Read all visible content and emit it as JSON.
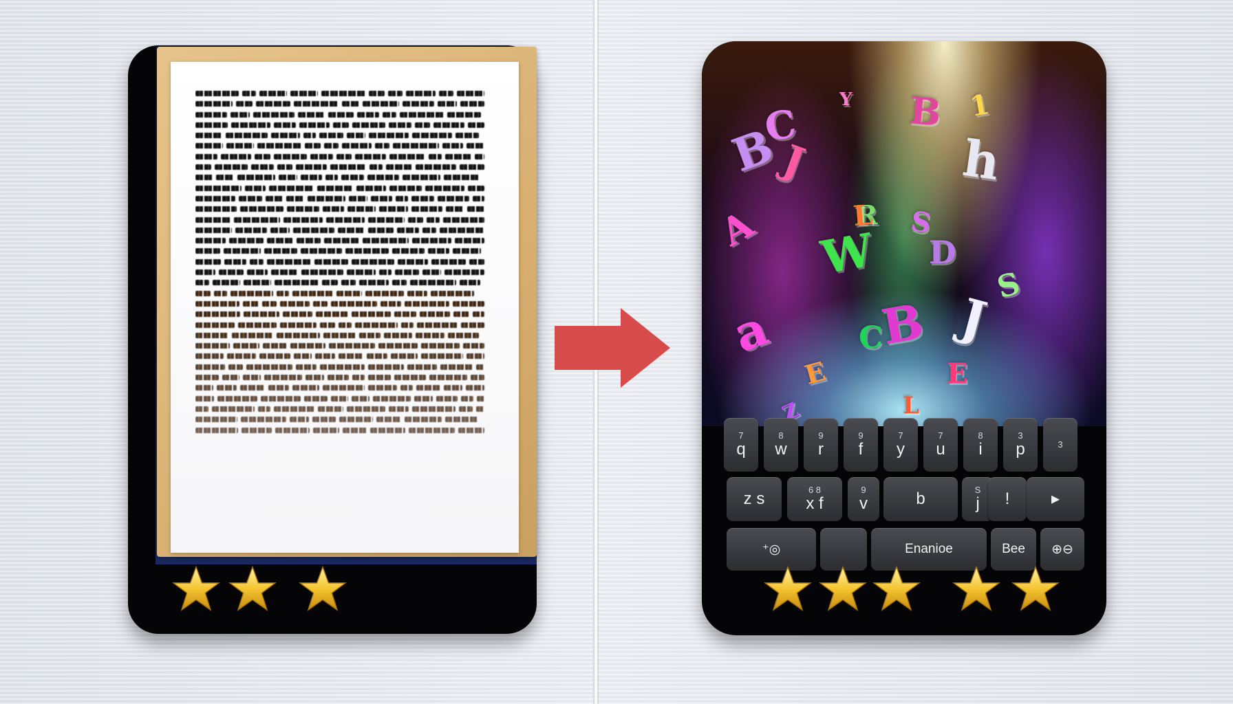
{
  "left_panel": {
    "document_lines": 33,
    "rating_stars": 3
  },
  "arrow": {
    "color": "#d84b4b"
  },
  "right_panel": {
    "letters": [
      "B",
      "C",
      "B",
      "h",
      "A",
      "J",
      "R",
      "L",
      "W",
      "S",
      "a",
      "B",
      "J",
      "C",
      "E",
      "L",
      "E",
      "Z",
      "D",
      "S",
      "Y",
      "1"
    ],
    "keyboard": {
      "row1": [
        {
          "sup": "7",
          "main": "q"
        },
        {
          "sup": "8",
          "main": "w"
        },
        {
          "sup": "9",
          "main": "r"
        },
        {
          "sup": "9",
          "main": "f"
        },
        {
          "sup": "7",
          "main": "y"
        },
        {
          "sup": "7",
          "main": "u"
        },
        {
          "sup": "8",
          "main": "i"
        },
        {
          "sup": "3",
          "main": "p"
        },
        {
          "sup": "3",
          "main": ""
        }
      ],
      "row2": [
        {
          "sup": "",
          "main": "z s"
        },
        {
          "sup": "6 8",
          "main": "x f"
        },
        {
          "sup": "9",
          "main": "v"
        },
        {
          "sup": "",
          "main": "b"
        },
        {
          "sup": "S",
          "main": "j"
        },
        {
          "sup": "",
          "main": "!"
        },
        {
          "sup": "",
          "main": "▸"
        }
      ],
      "row3": {
        "left_key": "⁺◎",
        "space_key": "Enanioe",
        "key_bee": "Bee",
        "key_globe": "⊕⊖"
      }
    },
    "rating_stars": 5
  },
  "colors": {
    "star": "#f5c531",
    "tablet": "#050507",
    "folder": "#d9b072"
  }
}
